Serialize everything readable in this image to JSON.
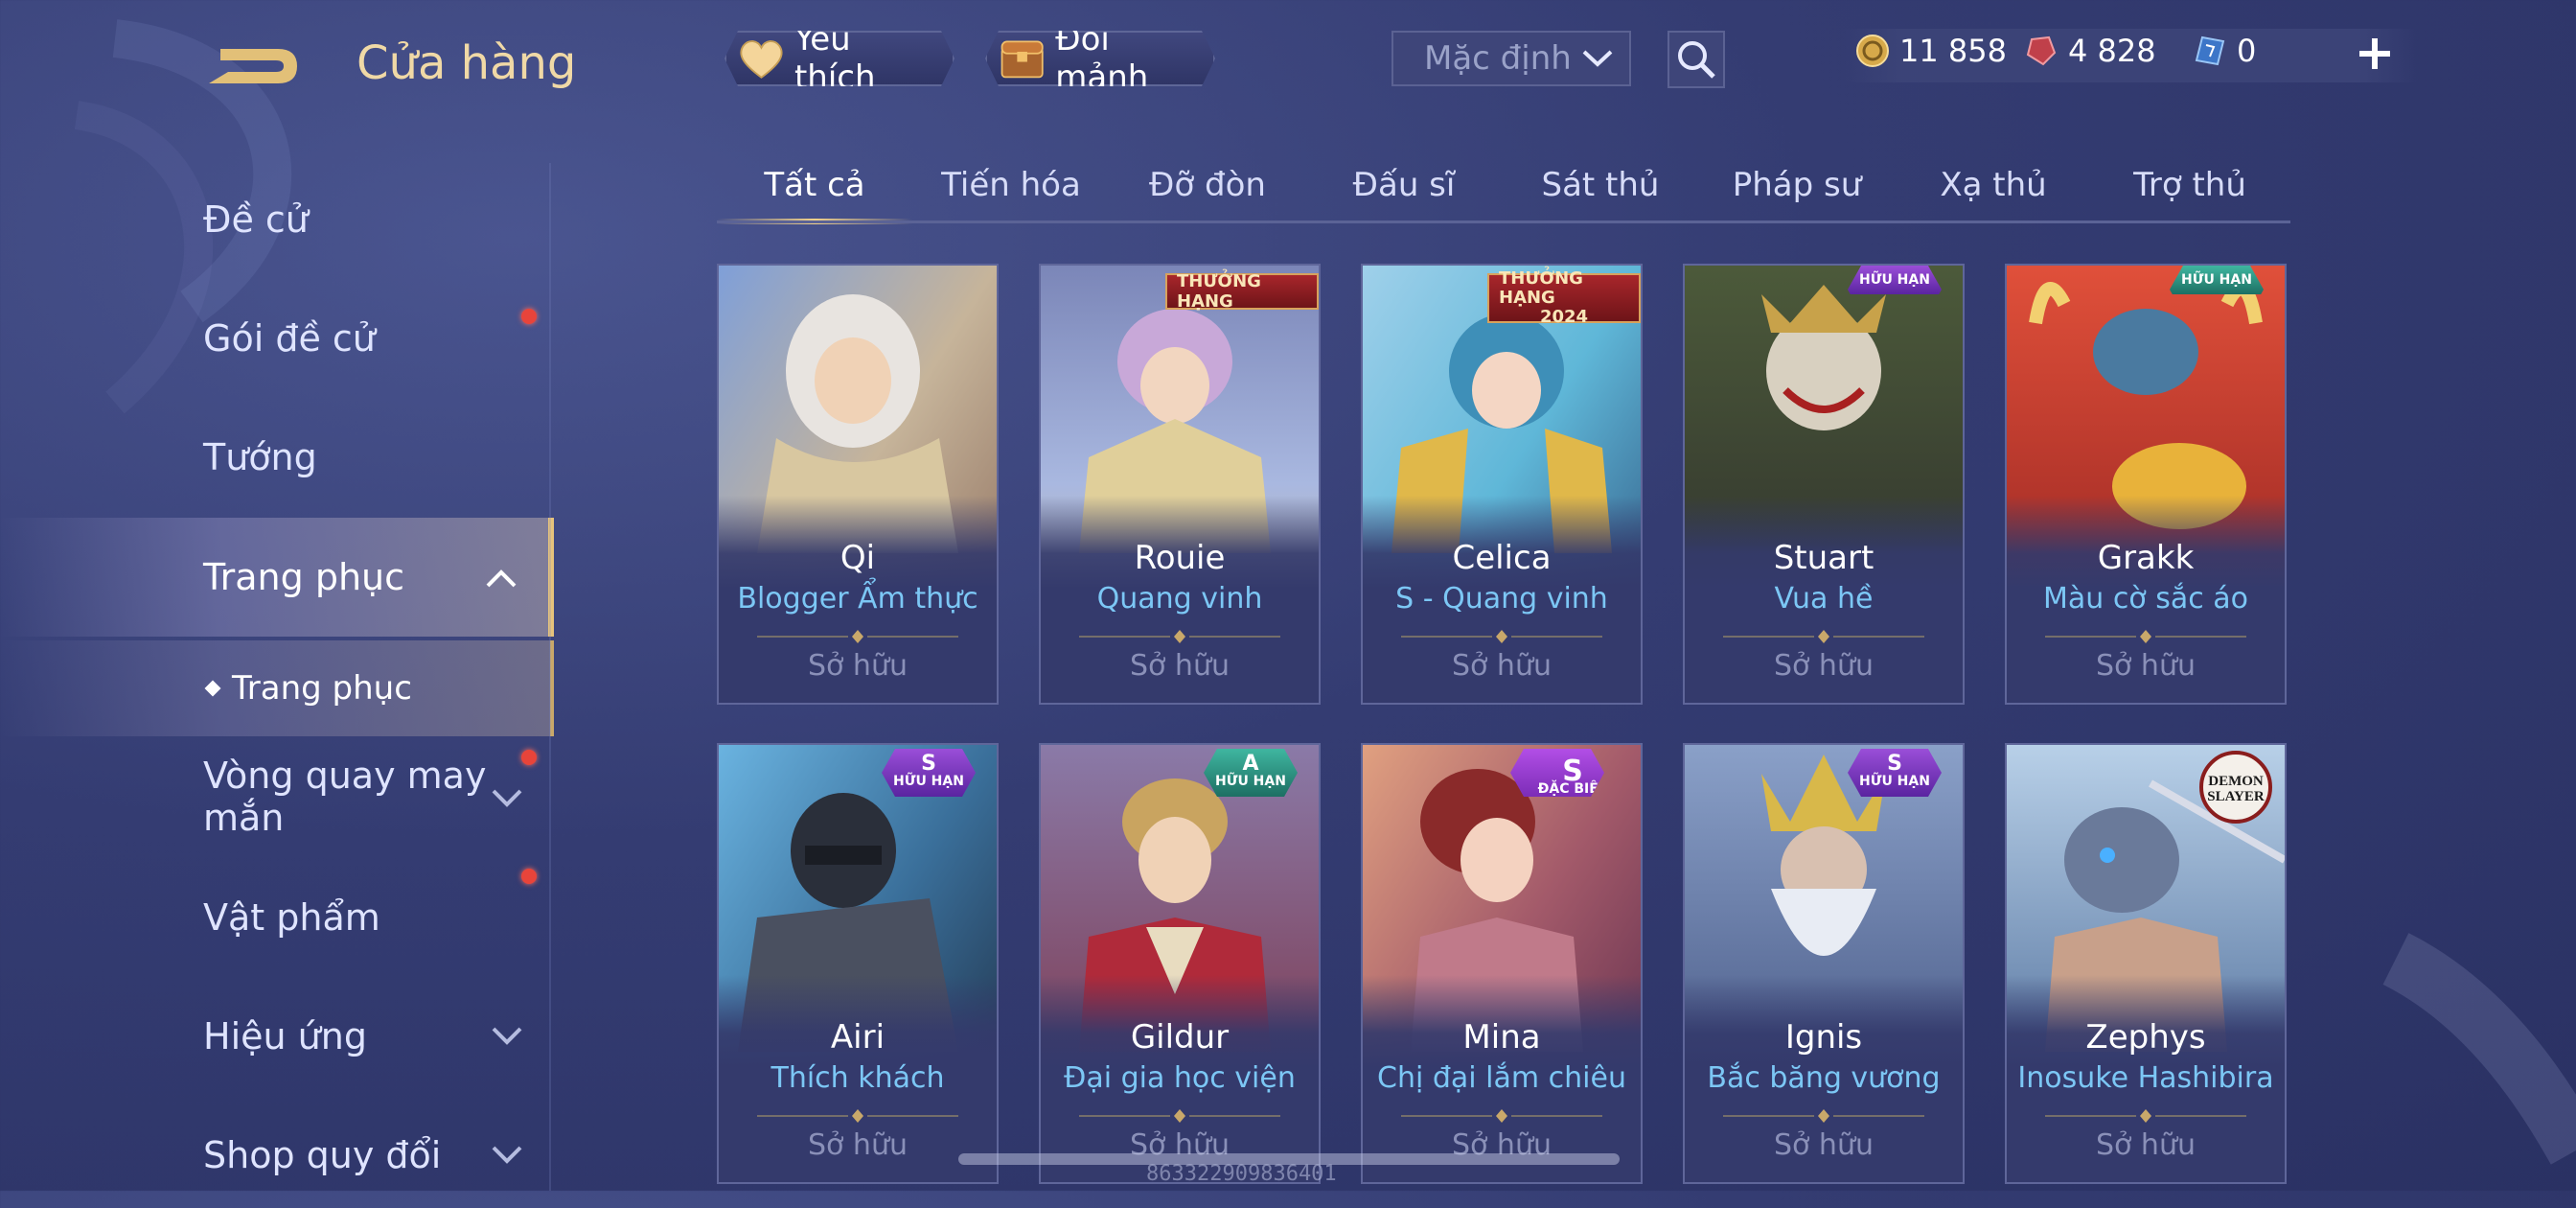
{
  "header": {
    "title": "Cửa hàng",
    "favorites_label": "Yêu thích",
    "shards_label": "Đổi mảnh",
    "sort_value": "Mặc định"
  },
  "currency": {
    "gold": "11 858",
    "gems": "4 828",
    "vouchers": "0"
  },
  "sidebar": {
    "items": [
      {
        "label": "Đề cử",
        "has_dot": false
      },
      {
        "label": "Gói đề cử",
        "has_dot": true
      },
      {
        "label": "Tướng",
        "has_dot": false
      },
      {
        "label": "Trang phục",
        "has_dot": false,
        "expanded": true
      },
      {
        "label": "Vòng quay may mắn",
        "has_dot": true
      },
      {
        "label": "Vật phẩm",
        "has_dot": true
      },
      {
        "label": "Hiệu ứng",
        "has_dot": false
      },
      {
        "label": "Shop quy đổi",
        "has_dot": false
      }
    ],
    "sub_item": "Trang phục"
  },
  "tabs": [
    "Tất cả",
    "Tiến hóa",
    "Đỡ đòn",
    "Đấu sĩ",
    "Sát thủ",
    "Pháp sư",
    "Xạ thủ",
    "Trợ thủ"
  ],
  "active_tab": 0,
  "cards": [
    {
      "hero": "Qi",
      "skin": "Blogger Ẩm thực",
      "status": "Sở hữu",
      "art_colors": [
        "#c6b49a",
        "#8a6a5a",
        "#d8c7a0"
      ]
    },
    {
      "hero": "Rouie",
      "skin": "Quang vinh",
      "status": "Sở hữu",
      "badge": "THƯỞNG HẠNG",
      "art_colors": [
        "#a9b8e0",
        "#d6c391",
        "#7b86b8"
      ]
    },
    {
      "hero": "Celica",
      "skin": "S - Quang vinh",
      "status": "Sở hữu",
      "badge": "THƯỞNG HẠNG",
      "badge_year": "2024",
      "art_colors": [
        "#5fb7d8",
        "#e0b84a",
        "#2c4f7a"
      ]
    },
    {
      "hero": "Stuart",
      "skin": "Vua hề",
      "status": "Sở hữu",
      "badge": "HỮU HẠN",
      "art_colors": [
        "#4c5a3a",
        "#7f8a6a",
        "#2a2a2a"
      ]
    },
    {
      "hero": "Grakk",
      "skin": "Màu cờ sắc áo",
      "status": "Sở hữu",
      "badge": "HỮU HẠN",
      "art_colors": [
        "#c8332d",
        "#e8b23a",
        "#8a1d1d"
      ]
    },
    {
      "hero": "Airi",
      "skin": "Thích khách",
      "status": "Sở hữu",
      "tier": "S",
      "badge": "HỮU HẠN",
      "art_colors": [
        "#3a6f9a",
        "#1d2a3e",
        "#6ab3e0"
      ]
    },
    {
      "hero": "Gildur",
      "skin": "Đại gia học viện",
      "status": "Sở hữu",
      "tier": "A",
      "badge": "HỮU HẠN",
      "art_colors": [
        "#c9a460",
        "#7a2a3a",
        "#e8dcc0"
      ]
    },
    {
      "hero": "Mina",
      "skin": "Chị đại lắm chiêu",
      "status": "Sở hữu",
      "tier": "S",
      "badge": "ĐẶC BIỆT",
      "art_colors": [
        "#a35a6a",
        "#e0a080",
        "#5a2a4a"
      ]
    },
    {
      "hero": "Ignis",
      "skin": "Bắc băng vương",
      "status": "Sở hữu",
      "tier": "S",
      "badge": "HỮU HẠN",
      "art_colors": [
        "#8aa0c8",
        "#e8ecf4",
        "#3a4a78"
      ]
    },
    {
      "hero": "Zephys",
      "skin": "Inosuke Hashibira",
      "status": "Sở hữu",
      "badge": "DEMON SLAYER",
      "art_colors": [
        "#8ab0d8",
        "#c8a08a",
        "#3a5a8a"
      ]
    }
  ],
  "footer": {
    "uid": "863322909836401"
  }
}
